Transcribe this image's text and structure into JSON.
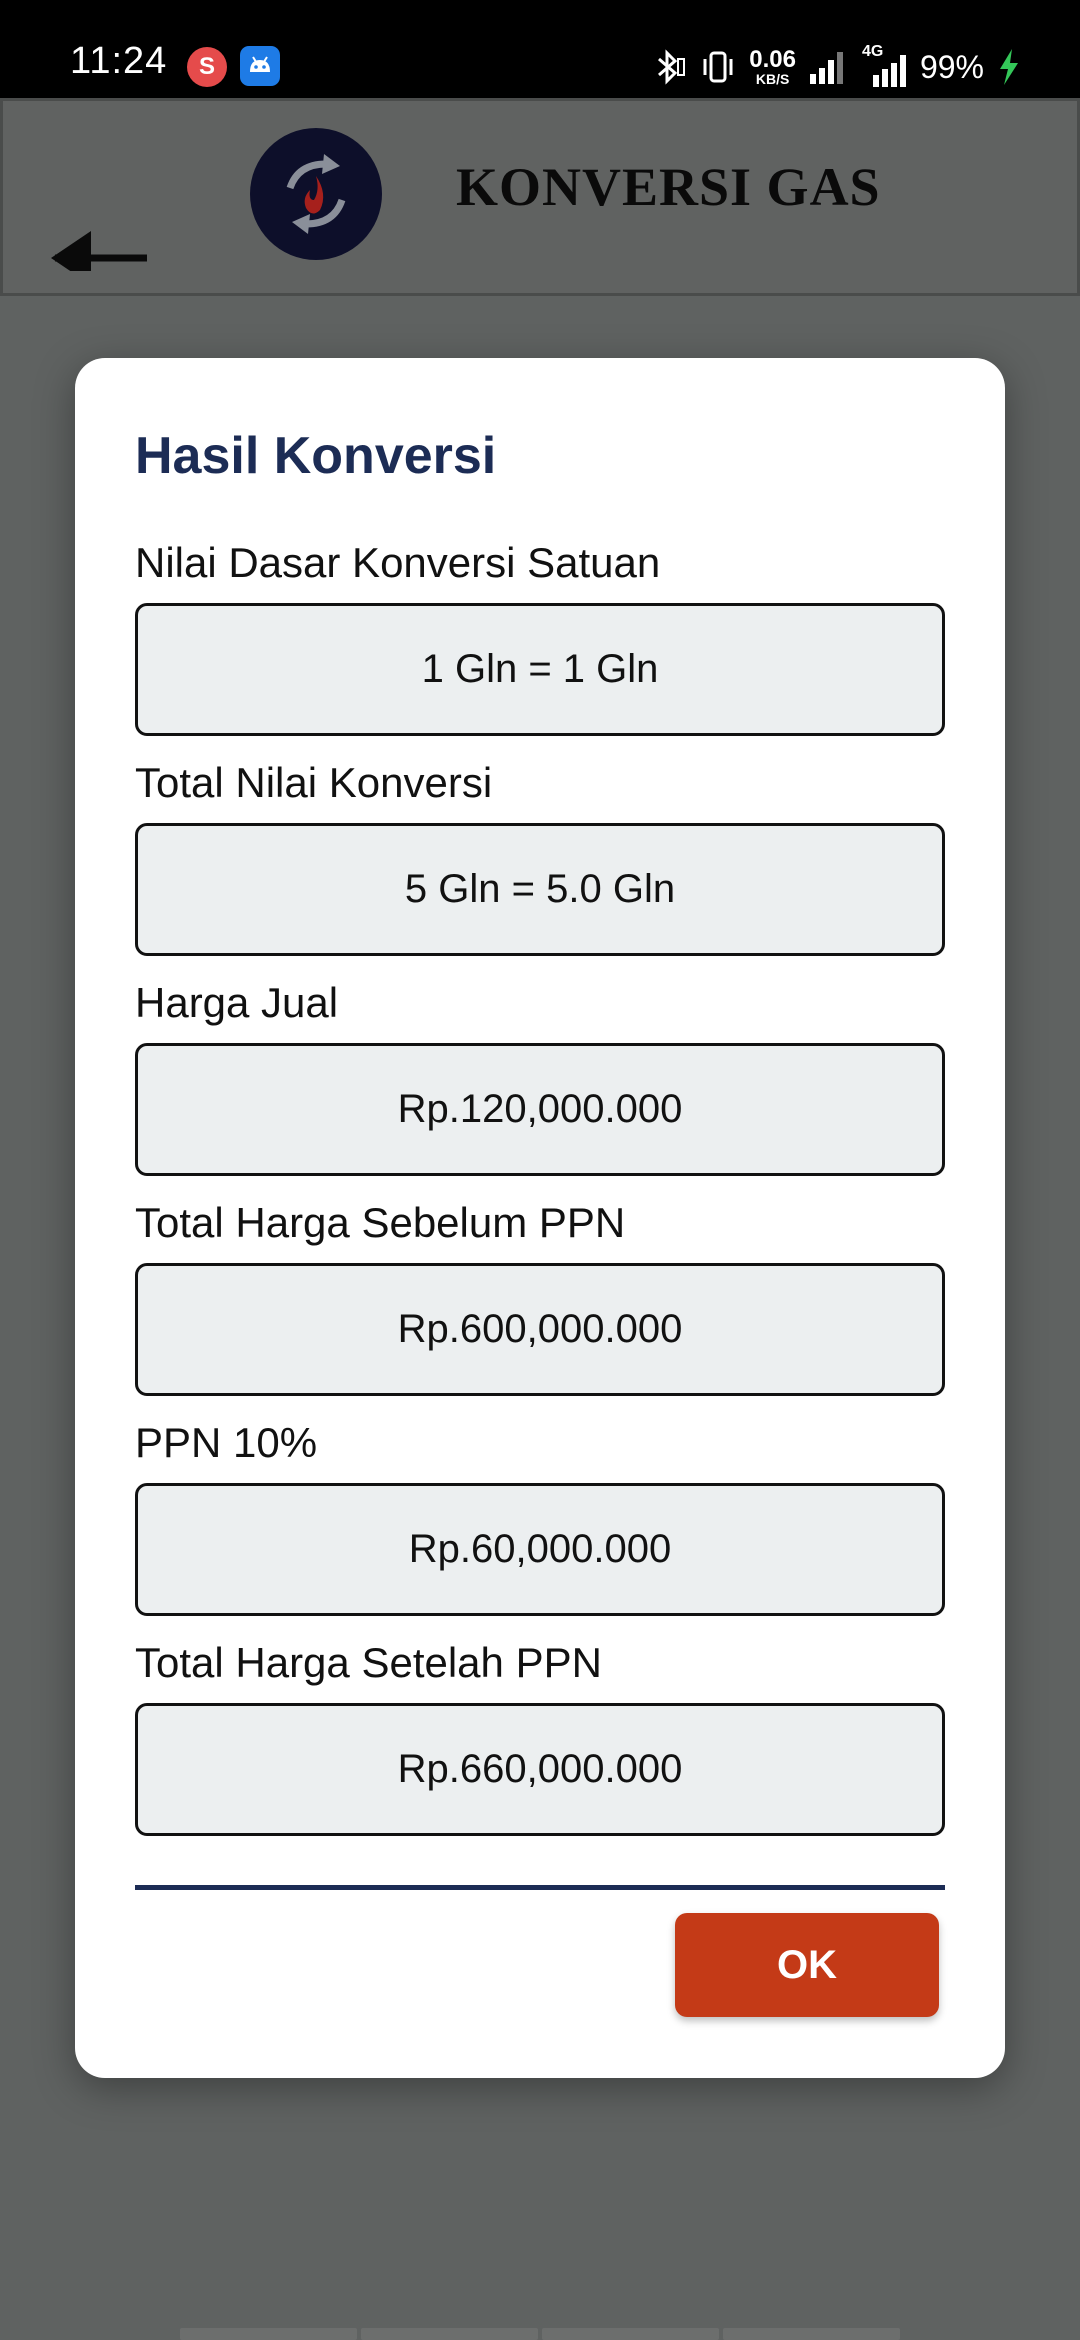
{
  "status_bar": {
    "time": "11:24",
    "app_badge_letter": "S",
    "net_speed_value": "0.06",
    "net_speed_unit": "KB/S",
    "network_type": "4G",
    "battery": "99%"
  },
  "app_bar": {
    "title": "KONVERSI GAS",
    "back_icon": "arrow-left-icon",
    "logo_icon": "gas-conversion-logo"
  },
  "dialog": {
    "title": "Hasil Konversi",
    "fields": [
      {
        "label": "Nilai Dasar Konversi Satuan",
        "value": "1 Gln = 1 Gln"
      },
      {
        "label": "Total Nilai Konversi",
        "value": "5 Gln = 5.0 Gln"
      },
      {
        "label": "Harga Jual",
        "value": "Rp.120,000.000"
      },
      {
        "label": "Total Harga Sebelum PPN",
        "value": "Rp.600,000.000"
      },
      {
        "label": "PPN 10%",
        "value": "Rp.60,000.000"
      },
      {
        "label": "Total Harga Setelah PPN",
        "value": "Rp.660,000.000"
      }
    ],
    "ok_label": "OK"
  },
  "colors": {
    "title_navy": "#1c2c55",
    "ok_button": "#c43a17",
    "field_bg": "#eceff0",
    "scrim": "#5f6261"
  }
}
